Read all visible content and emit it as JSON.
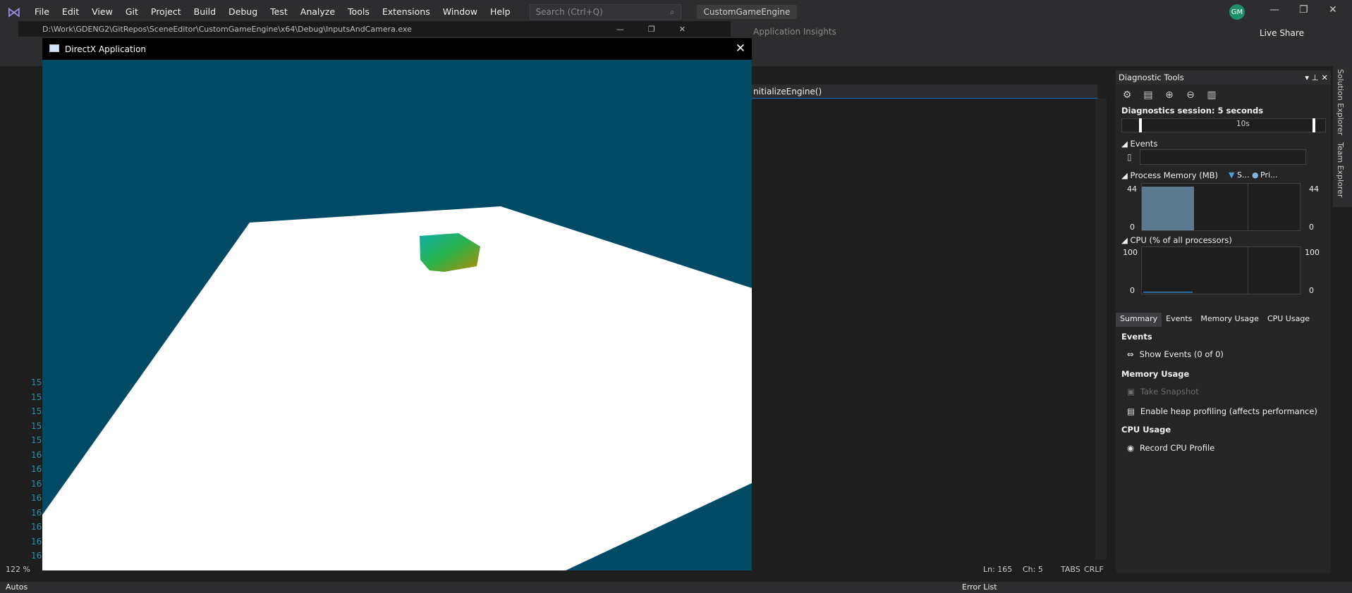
{
  "menubar": {
    "items": [
      "File",
      "Edit",
      "View",
      "Git",
      "Project",
      "Build",
      "Debug",
      "Test",
      "Analyze",
      "Tools",
      "Extensions",
      "Window",
      "Help"
    ],
    "search_placeholder": "Search (Ctrl+Q)",
    "solution_name": "CustomGameEngine",
    "avatar_initials": "GM"
  },
  "toolbar": {
    "app_insights": "Application Insights",
    "live_share": "Live Share"
  },
  "console": {
    "path": "D:\\Work\\GDENG2\\GitRepos\\SceneEditor\\CustomGameEngine\\x64\\Debug\\InputsAndCamera.exe"
  },
  "editor": {
    "nav_method": "nitializeEngine()",
    "line_numbers": [
      "15",
      "15",
      "15",
      "15",
      "15",
      "16",
      "16",
      "16",
      "16",
      "16",
      "16",
      "16",
      "16"
    ],
    "zoom": "122 %",
    "status": {
      "ln": "Ln: 165",
      "ch": "Ch: 5",
      "tabs": "TABS",
      "crlf": "CRLF"
    }
  },
  "dx_window": {
    "title": "DirectX Application",
    "background_color": "#004a66",
    "plane_color": "#ffffff"
  },
  "diagnostics": {
    "title": "Diagnostic Tools",
    "session": "Diagnostics session: 5 seconds",
    "timeline_mark": "10s",
    "events_label": "Events",
    "memory_label": "Process Memory (MB)",
    "memory_legend_s": "S...",
    "memory_legend_p": "Pri...",
    "memory_max": "44",
    "memory_min": "0",
    "memory_level_fraction": 1.0,
    "cpu_label": "CPU (% of all processors)",
    "cpu_max": "100",
    "cpu_min": "0",
    "tabs": [
      "Summary",
      "Events",
      "Memory Usage",
      "CPU Usage"
    ],
    "summary": {
      "events_heading": "Events",
      "show_events": "Show Events (0 of 0)",
      "memory_heading": "Memory Usage",
      "take_snapshot": "Take Snapshot",
      "heap_profiling": "Enable heap profiling (affects performance)",
      "cpu_heading": "CPU Usage",
      "record_cpu": "Record CPU Profile"
    }
  },
  "vertical_tabs": [
    "Solution Explorer",
    "Team Explorer"
  ],
  "bottom": {
    "autos": "Autos",
    "error_list": "Error List"
  }
}
